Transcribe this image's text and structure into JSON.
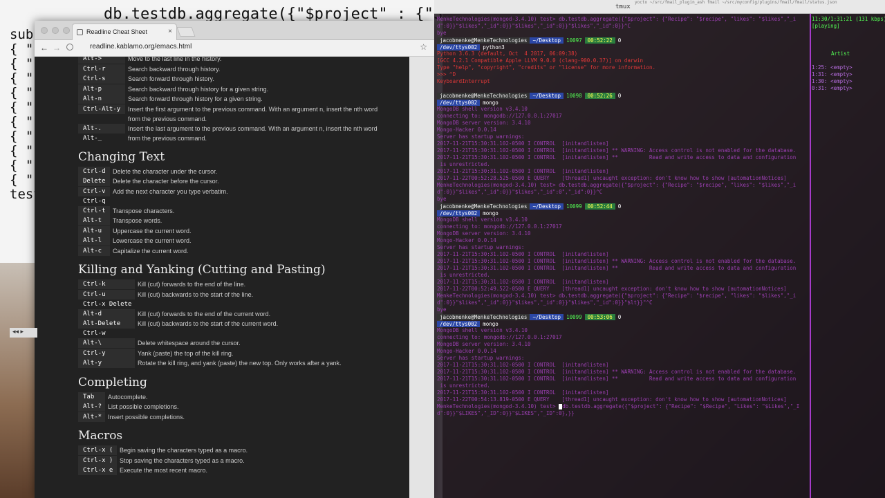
{
  "background": {
    "code_line": "db.testdb.aggregate({\"$project\" : {\"Strong",
    "left_prefix": "sub",
    "left_chars": [
      "{ \"",
      "{ \"",
      "{ \"",
      "{ \"",
      "{ \"",
      "{ \"",
      "{ \"",
      "{ \"",
      "{ \"",
      "{ \""
    ],
    "footer": "test"
  },
  "browser": {
    "tab_title": "Readline Cheat Sheet",
    "close_glyph": "×",
    "url": "readline.kablamo.org/emacs.html",
    "top_rows": [
      {
        "key": "Alt->",
        "desc": "Move to the last line in the history."
      },
      {
        "key": "Ctrl-r",
        "desc": "Search backward through history."
      },
      {
        "key": "Ctrl-s",
        "desc": "Search forward through history."
      },
      {
        "key": "Alt-p",
        "desc": "Search backward through history for a given string."
      },
      {
        "key": "Alt-n",
        "desc": "Search forward through history for a given string."
      },
      {
        "key": "Ctrl-Alt-y",
        "desc": "Insert the first argument to the previous command. With an argument n, insert the nth word",
        "desc2": "from the previous command."
      },
      {
        "key": "Alt-.",
        "key2": "Alt-_",
        "desc": "Insert the last argument to the previous command. With an argument n, insert the nth word",
        "desc2": "from the previous command."
      }
    ],
    "sections": [
      {
        "title": "Changing Text",
        "rows": [
          {
            "key": "Ctrl-d",
            "desc": "Delete the character under the cursor."
          },
          {
            "key": "Delete",
            "desc": "Delete the character before the cursor."
          },
          {
            "key": "Ctrl-v",
            "key2": "Ctrl-q",
            "desc": "Add the next character you type verbatim."
          },
          {
            "key": "Ctrl-t",
            "desc": "Transpose characters."
          },
          {
            "key": "Alt-t",
            "desc": "Transpose words."
          },
          {
            "key": "Alt-u",
            "desc": "Uppercase the current word."
          },
          {
            "key": "Alt-l",
            "desc": "Lowercase the current word."
          },
          {
            "key": "Alt-c",
            "desc": "Capitalize the current word."
          }
        ]
      },
      {
        "title": "Killing and Yanking (Cutting and Pasting)",
        "rows": [
          {
            "key": "Ctrl-k",
            "desc": "Kill (cut) forwards to the end of the line."
          },
          {
            "key": "Ctrl-u",
            "key2": "Ctrl-x Delete",
            "desc": "Kill (cut) backwards to the start of the line."
          },
          {
            "key": "Alt-d",
            "desc": "Kill (cut) forwards to the end of the current word."
          },
          {
            "key": "Alt-Delete",
            "key2": "Ctrl-w",
            "desc": "Kill (cut) backwards to the start of the current word."
          },
          {
            "key": "Alt-\\",
            "desc": "Delete whitespace around the cursor."
          },
          {
            "key": "Ctrl-y",
            "desc": "Yank (paste) the top of the kill ring."
          },
          {
            "key": "Alt-y",
            "desc": "Rotate the kill ring, and yank (paste) the new top. Only works after a yank."
          }
        ]
      },
      {
        "title": "Completing",
        "rows": [
          {
            "key": "Tab",
            "desc": "Autocomplete."
          },
          {
            "key": "Alt-?",
            "desc": "List possible completions."
          },
          {
            "key": "Alt-*",
            "desc": "Insert possible completions."
          }
        ]
      },
      {
        "title": "Macros",
        "rows": [
          {
            "key": "Ctrl-x (",
            "desc": "Begin saving the characters typed as a macro."
          },
          {
            "key": "Ctrl-x )",
            "desc": "Stop saving the characters typed as a macro."
          },
          {
            "key": "Ctrl-x e",
            "desc": "Execute the most recent macro."
          }
        ]
      }
    ],
    "scroll_arrows": "◂◂ ▸"
  },
  "terminal": {
    "title": "tmux",
    "title_right": "yocto  ~/src/fmail_plugin_ash  fmail  ~/src/myconfig/plugins/fmail/fmail/status.json",
    "prompts": {
      "user": "jacobmenke@MenkeTechnologies",
      "dir": "~/Desktop",
      "tty": "/dev/ttys002"
    },
    "lines": [
      "MenkeTechnologies(mongod-3.4.10) test> db.testdb.aggregate({\"$project\": {\"Recipe\": \"$recipe\", \"likes\": \"$likes\",\"_i",
      "d\":0}}\"$likes\",\"_id\":0}}\"$likes\",\"_id\":0}}\"$likes\",\"_id\":0}}^C",
      "bye",
      "Python 3.6.3 (default, Oct  4 2017, 06:09:38)",
      "[GCC 4.2.1 Compatible Apple LLVM 9.0.0 (clang-900.0.37)] on darwin",
      "Type \"help\", \"copyright\", \"credits\" or \"license\" for more information.",
      ">>> ^D",
      "KeyboardInterrupt",
      "MongoDB shell version v3.4.10",
      "connecting to: mongodb://127.0.0.1:27017",
      "MongoDB server version: 3.4.10",
      "Mongo-Hacker 0.0.14",
      "Server has startup warnings:",
      "2017-11-21T15:30:31.102-0500 I CONTROL  [initandlisten]",
      "2017-11-21T15:30:31.102-0500 I CONTROL  [initandlisten] ** WARNING: Access control is not enabled for the database.",
      "2017-11-21T15:30:31.102-0500 I CONTROL  [initandlisten] **          Read and write access to data and configuration",
      " is unrestricted.",
      "2017-11-21T15:30:31.102-0500 I CONTROL  [initandlisten]",
      "2017-11-22T00:52:28.525-0500 E QUERY    [thread1] uncaught exception: don't know how to show [automationNotices]",
      "MenkeTechnologies(mongod-3.4.10) test> db.testdb.aggregate({\"$project\": {\"Recipe\": \"$recipe\", \"likes\": \"$likes\",\"_i",
      "d\":0}}\"$likes\",\"_id\":0}}\"$likes\",\"_id\":0\",\"_id\":0}}^C",
      "2017-11-22T00:52:49.522-0500 E QUERY    [thread1] uncaught exception: don't know how to show [automationNotices]",
      "d\":0}}\"$likes\",\"_id\":0}}\"$likes\",\"_id\":0}}\"$likes\",\"_id\":0}}\"$lt}}\"^C",
      "2017-11-22T00:54:13.819-0500 E QUERY    [thread1] uncaught exception: don't know how to show [automationNotices]",
      "MenkeTechnologies(mongod-3.4.10) test> ",
      "db.testdb.aggregate({\"$project\": {\"Recipe\": \"$Recipe\", \"Likes\": \"$Likes\",\"_I",
      "d\":0}}\"$LIKES\",\"_ID\":0}}\"$LIKES\",\"_ID\":0},}}",
      "mongo",
      "python3",
      "bye"
    ],
    "prompt_meta": [
      {
        "num": "10097",
        "time": "00:52:22",
        "zero": "0",
        "cmd": "python3"
      },
      {
        "num": "10098",
        "time": "00:52:26",
        "zero": "0",
        "cmd": "mongo"
      },
      {
        "num": "10099",
        "time": "00:52:44",
        "zero": "0",
        "cmd": "mongo"
      },
      {
        "num": "10099",
        "time": "00:53:06",
        "zero": "0",
        "cmd": "mongo"
      }
    ],
    "right": {
      "status": "11:30/1:31:21 (131 kbps)",
      "state": "[playing]",
      "header": "Artist",
      "rows": [
        "1:25: <empty>",
        "1:31: <empty>",
        "1:30: <empty>",
        "0:31: <empty>"
      ]
    }
  }
}
